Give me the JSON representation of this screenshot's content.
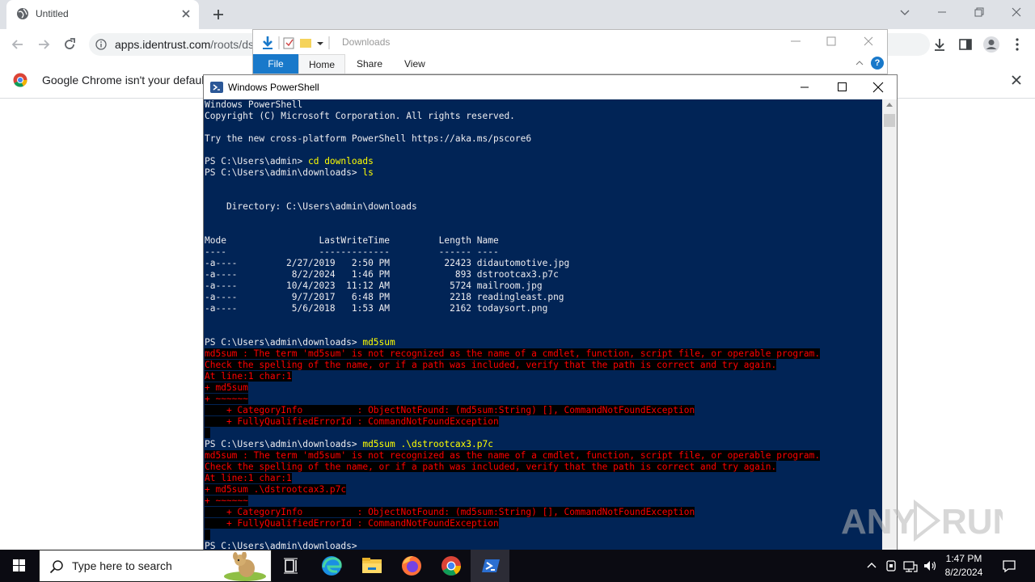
{
  "browser": {
    "tab_title": "Untitled",
    "url_host": "apps.identrust.com",
    "url_path": "/roots/ds",
    "infobar_message": "Google Chrome isn't your default"
  },
  "explorer": {
    "title": "Downloads",
    "tabs": [
      "File",
      "Home",
      "Share",
      "View"
    ],
    "help_label": "?"
  },
  "powershell": {
    "title": "Windows PowerShell",
    "lines": [
      {
        "t": "Windows PowerShell"
      },
      {
        "t": "Copyright (C) Microsoft Corporation. All rights reserved."
      },
      {
        "t": ""
      },
      {
        "t": "Try the new cross-platform PowerShell https://aka.ms/pscore6"
      },
      {
        "t": ""
      },
      {
        "t": "PS C:\\Users\\admin> ",
        "cmd": "cd downloads"
      },
      {
        "t": "PS C:\\Users\\admin\\downloads> ",
        "cmd": "ls"
      },
      {
        "t": ""
      },
      {
        "t": ""
      },
      {
        "t": "    Directory: C:\\Users\\admin\\downloads"
      },
      {
        "t": ""
      },
      {
        "t": ""
      },
      {
        "t": "Mode                 LastWriteTime         Length Name"
      },
      {
        "t": "----                 -------------         ------ ----"
      },
      {
        "t": "-a----         2/27/2019   2:50 PM          22423 didautomotive.jpg"
      },
      {
        "t": "-a----          8/2/2024   1:46 PM            893 dstrootcax3.p7c"
      },
      {
        "t": "-a----         10/4/2023  11:12 AM           5724 mailroom.jpg"
      },
      {
        "t": "-a----          9/7/2017   6:48 PM           2218 readingleast.png"
      },
      {
        "t": "-a----          5/6/2018   1:53 AM           2162 todaysort.png"
      },
      {
        "t": ""
      },
      {
        "t": ""
      },
      {
        "t": "PS C:\\Users\\admin\\downloads> ",
        "cmd": "md5sum"
      },
      {
        "err": "md5sum : The term 'md5sum' is not recognized as the name of a cmdlet, function, script file, or operable program."
      },
      {
        "err": "Check the spelling of the name, or if a path was included, verify that the path is correct and try again."
      },
      {
        "err": "At line:1 char:1"
      },
      {
        "err": "+ md5sum"
      },
      {
        "err": "+ ~~~~~~"
      },
      {
        "err": "    + CategoryInfo          : ObjectNotFound: (md5sum:String) [], CommandNotFoundException"
      },
      {
        "err": "    + FullyQualifiedErrorId : CommandNotFoundException"
      },
      {
        "err": " "
      },
      {
        "t": "PS C:\\Users\\admin\\downloads> ",
        "cmd": "md5sum .\\dstrootcax3.p7c"
      },
      {
        "err": "md5sum : The term 'md5sum' is not recognized as the name of a cmdlet, function, script file, or operable program."
      },
      {
        "err": "Check the spelling of the name, or if a path was included, verify that the path is correct and try again."
      },
      {
        "err": "At line:1 char:1"
      },
      {
        "err": "+ md5sum .\\dstrootcax3.p7c"
      },
      {
        "err": "+ ~~~~~~"
      },
      {
        "err": "    + CategoryInfo          : ObjectNotFound: (md5sum:String) [], CommandNotFoundException"
      },
      {
        "err": "    + FullyQualifiedErrorId : CommandNotFoundException"
      },
      {
        "err": " "
      },
      {
        "t": "PS C:\\Users\\admin\\downloads> "
      }
    ]
  },
  "taskbar": {
    "search_placeholder": "Type here to search",
    "time": "1:47 PM",
    "date": "8/2/2024"
  },
  "watermark": "ANY RUN"
}
